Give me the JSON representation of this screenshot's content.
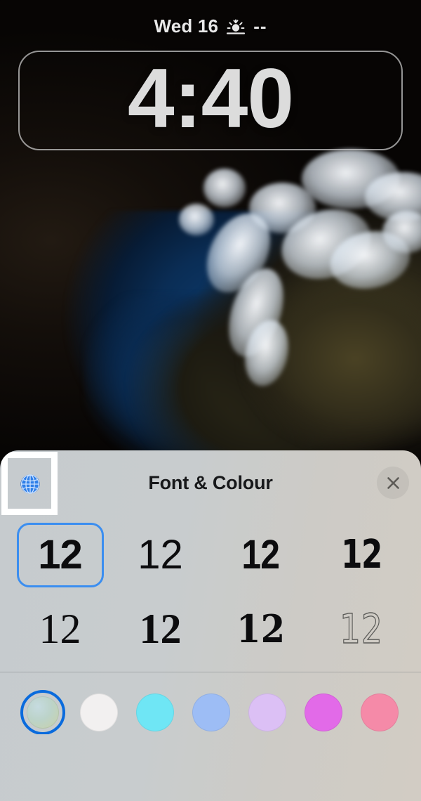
{
  "lock_screen": {
    "date": "Wed 16",
    "weather_icon": "sunset-icon",
    "temperature": "--",
    "clock": "4:40"
  },
  "panel": {
    "title": "Font & Colour",
    "globe_icon": "globe-icon",
    "close_icon": "close-icon",
    "fonts": [
      {
        "sample": "12",
        "style": "sans-bold",
        "selected": true
      },
      {
        "sample": "12",
        "style": "sans-light",
        "selected": false
      },
      {
        "sample": "12",
        "style": "sans-condensed",
        "selected": false
      },
      {
        "sample": "12",
        "style": "sans-slant",
        "selected": false
      },
      {
        "sample": "12",
        "style": "serif-regular",
        "selected": false
      },
      {
        "sample": "12",
        "style": "serif-bold",
        "selected": false
      },
      {
        "sample": "12",
        "style": "slab-serif",
        "selected": false
      },
      {
        "sample": "12",
        "style": "outline-inline",
        "selected": false
      }
    ],
    "colours": [
      {
        "name": "natural",
        "hex": "#b9cdc4",
        "selected": true
      },
      {
        "name": "white",
        "hex": "#f2f0f0",
        "selected": false
      },
      {
        "name": "cyan",
        "hex": "#6fe6f5",
        "selected": false
      },
      {
        "name": "blue",
        "hex": "#9dbdf5",
        "selected": false
      },
      {
        "name": "lavender",
        "hex": "#dcc0f5",
        "selected": false
      },
      {
        "name": "magenta",
        "hex": "#e26ae8",
        "selected": false
      },
      {
        "name": "pink",
        "hex": "#f58aa8",
        "selected": false
      }
    ],
    "accent_colour": "#3b8ef0",
    "selection_ring_colour": "#0a6bdd"
  }
}
